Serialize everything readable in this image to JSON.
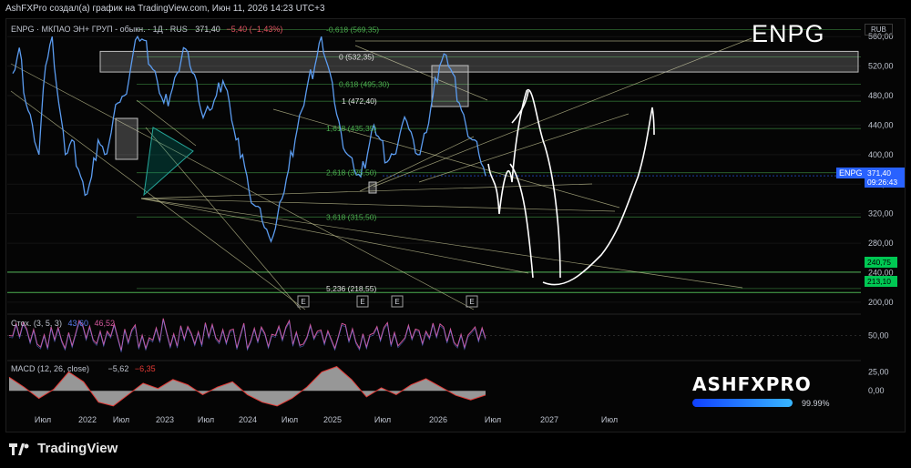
{
  "top_caption": "AshFXPro создал(а) график на TradingView.com, Июн 11, 2026 14:23 UTC+3",
  "legend": {
    "symbol": "ENPG · МКПАО ЭН+ ГРУП - обыкн. · 1Д · RUS",
    "value": "371,40",
    "change": "−5,40 (−1,43%)"
  },
  "ticker_watermark": "ENPG",
  "currency": "RUB",
  "price_badge": {
    "symbol": "ENPG",
    "price": "371,40",
    "timer": "09:26:43"
  },
  "level_badges": [
    {
      "label": "240,75",
      "value": 240.75
    },
    {
      "label": "213,10",
      "value": 213.1
    }
  ],
  "fib_labels": [
    {
      "text": "-0,618 (569,35)",
      "value": 569.35
    },
    {
      "text": "0 (532,35)",
      "value": 532.35
    },
    {
      "text": "0,618 (495,30)",
      "value": 495.3
    },
    {
      "text": "1 (472,40)",
      "value": 472.4
    },
    {
      "text": "1,618 (435,35)",
      "value": 435.35
    },
    {
      "text": "2,618 (375,50)",
      "value": 375.5
    },
    {
      "text": "3,618 (315,50)",
      "value": 315.5
    },
    {
      "text": "5,236 (218,55)",
      "value": 218.55
    }
  ],
  "events": [
    "E",
    "E",
    "E",
    "E"
  ],
  "stoch_legend": {
    "label": "Стох. (3, 5, 3)",
    "k": "43,60",
    "d": "46,52"
  },
  "macd_legend": {
    "label": "MACD (12, 26, close)",
    "v1": "−5,62",
    "v2": "−6,35"
  },
  "brand": {
    "name": "ASHFXPRO",
    "percent": "99.99%"
  },
  "footer": {
    "text": "TradingView"
  },
  "colors": {
    "price": "#5b9cf0",
    "fib": "#4caf50",
    "trend": "#c8c896",
    "stoch": "#d1579a",
    "macd_line": "#e53935",
    "badge_blue": "#2962ff",
    "badge_green": "#00c853"
  },
  "chart_data": [
    {
      "type": "line",
      "title": "ENPG · МКПАО ЭН+ ГРУП - обыкн. · 1Д · RUS",
      "x_ticks": [
        "Июл",
        "2022",
        "Июл",
        "2023",
        "Июл",
        "2024",
        "Июл",
        "2025",
        "Июл",
        "2026",
        "Июл",
        "2027",
        "Июл"
      ],
      "y_ticks": [
        "560,00",
        "520,00",
        "480,00",
        "440,00",
        "400,00",
        "360,00",
        "320,00",
        "280,00",
        "240,00",
        "200,00"
      ],
      "ylim": [
        190,
        580
      ],
      "series": [
        {
          "values": [
            510,
            545,
            470,
            440,
            400,
            520,
            560,
            470,
            400,
            420,
            380,
            345,
            370,
            420,
            400,
            430,
            470,
            480,
            520,
            560,
            555,
            520,
            500,
            470,
            480,
            510,
            545,
            520,
            500,
            450,
            460,
            480,
            500,
            470,
            420,
            400,
            350,
            330,
            310,
            290,
            300,
            340,
            380,
            420,
            460,
            500,
            520,
            560,
            520,
            470,
            430,
            400,
            380,
            370,
            400,
            440,
            420,
            390,
            400,
            430,
            445,
            420,
            400,
            430,
            480,
            520,
            535,
            510,
            470,
            440,
            420,
            400,
            371.4
          ]
        }
      ]
    },
    {
      "type": "line",
      "title": "Стох. (3, 5, 3)",
      "y_ticks": [
        "50,00"
      ],
      "ylim": [
        0,
        100
      ],
      "series": [
        {
          "values": [
            50,
            80,
            30,
            70,
            20,
            85,
            40,
            60,
            15,
            75,
            45,
            90,
            25,
            55,
            80,
            35,
            65,
            20,
            70,
            50,
            85,
            30,
            60,
            40,
            75,
            20,
            55,
            80,
            35,
            65,
            45,
            70,
            25,
            60,
            43.6
          ]
        }
      ]
    },
    {
      "type": "area",
      "title": "MACD (12, 26, close)",
      "y_ticks": [
        "25,00",
        "0,00"
      ],
      "ylim": [
        -25,
        40
      ],
      "series": [
        {
          "values": [
            18,
            5,
            -10,
            2,
            25,
            12,
            -15,
            -20,
            -5,
            10,
            3,
            15,
            8,
            -5,
            5,
            12,
            -5,
            -15,
            -20,
            -10,
            5,
            25,
            32,
            15,
            -8,
            4,
            -5,
            8,
            16,
            5,
            -6,
            -12,
            -5.62
          ]
        }
      ]
    }
  ]
}
